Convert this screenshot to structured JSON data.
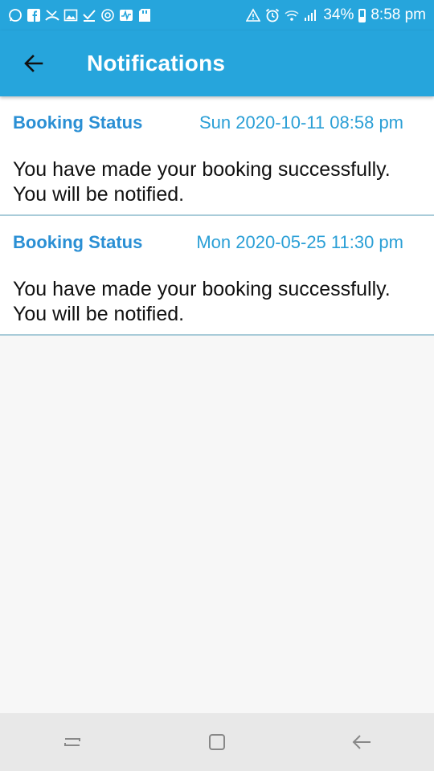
{
  "status_bar": {
    "battery": "34%",
    "time": "8:58 pm",
    "icons": [
      "whatsapp-icon",
      "facebook-icon",
      "missed-call-icon",
      "image-icon",
      "check-download-icon",
      "sync-icon",
      "activity-icon",
      "sd-card-icon",
      "alert-icon",
      "alarm-icon",
      "wifi-icon",
      "signal-icon",
      "battery-icon"
    ]
  },
  "app_bar": {
    "title": "Notifications"
  },
  "notifications": [
    {
      "title": "Booking Status",
      "date": "Sun 2020-10-11 08:58 pm",
      "message": "You have made your booking successfully. You will be notified."
    },
    {
      "title": "Booking Status",
      "date": "Mon 2020-05-25 11:30 pm",
      "message": "You have made your booking successfully. You will be notified."
    }
  ],
  "colors": {
    "primary": "#26a5dc",
    "title_text": "#2a8fd4",
    "divider": "#a9ccd9"
  }
}
